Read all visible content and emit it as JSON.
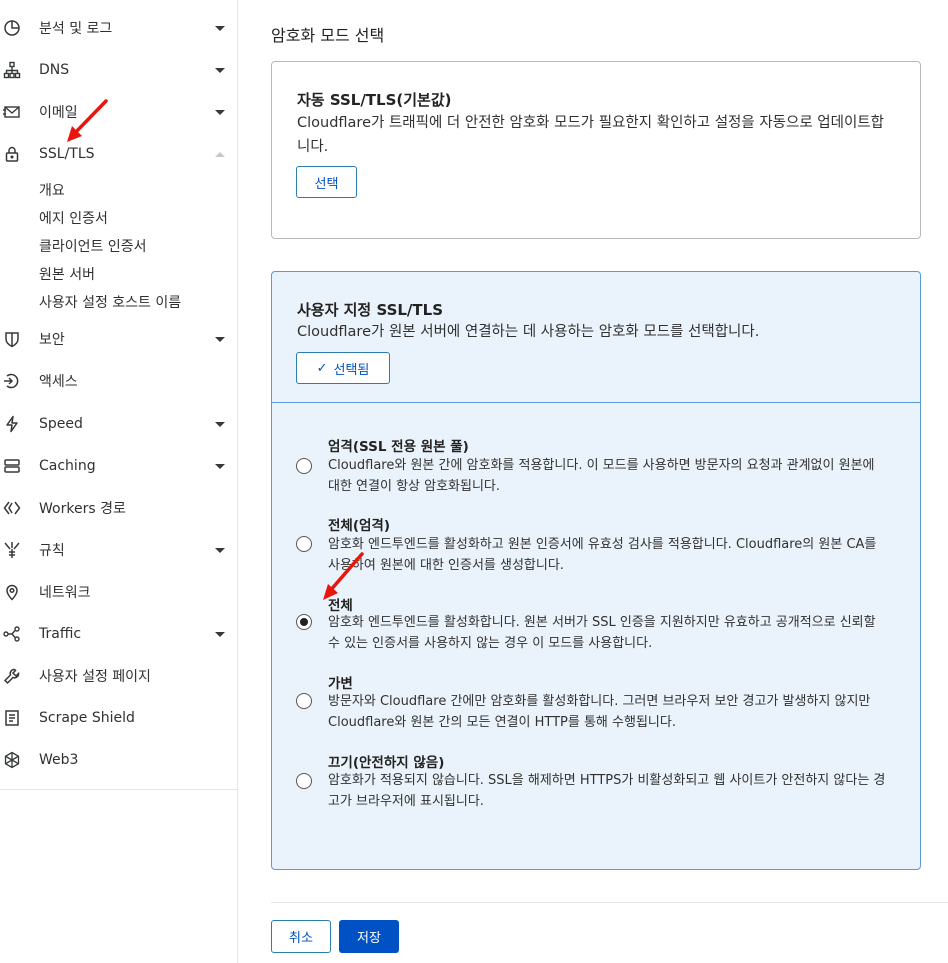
{
  "sidebar": {
    "items": [
      {
        "label": "분석 및 로그",
        "icon": "analytics-icon"
      },
      {
        "label": "DNS",
        "icon": "dns-icon"
      },
      {
        "label": "이메일",
        "icon": "email-icon"
      },
      {
        "label": "SSL/TLS",
        "icon": "lock-icon"
      },
      {
        "label": "보안",
        "icon": "shield-icon"
      },
      {
        "label": "액세스",
        "icon": "access-icon"
      },
      {
        "label": "Speed",
        "icon": "bolt-icon"
      },
      {
        "label": "Caching",
        "icon": "caching-icon"
      },
      {
        "label": "Workers 경로",
        "icon": "workers-icon"
      },
      {
        "label": "규칙",
        "icon": "rules-icon"
      },
      {
        "label": "네트워크",
        "icon": "location-pin-icon"
      },
      {
        "label": "Traffic",
        "icon": "traffic-icon"
      },
      {
        "label": "사용자 설정 페이지",
        "icon": "wrench-icon"
      },
      {
        "label": "Scrape Shield",
        "icon": "document-icon"
      },
      {
        "label": "Web3",
        "icon": "web3-icon"
      }
    ],
    "ssl_sub_items": [
      "개요",
      "에지 인증서",
      "클라이언트 인증서",
      "원본 서버",
      "사용자 설정 호스트 이름"
    ]
  },
  "main": {
    "section_title": "암호화 모드 선택",
    "auto": {
      "title": "자동 SSL/TLS(기본값)",
      "desc": "Cloudflare가 트래픽에 더 안전한 암호화 모드가 필요한지 확인하고 설정을 자동으로 업데이트합니다.",
      "button": "선택"
    },
    "custom": {
      "title": "사용자 지정 SSL/TLS",
      "desc": "Cloudflare가 원본 서버에 연결하는 데 사용하는 암호화 모드를 선택합니다.",
      "button": "선택됨",
      "options": [
        {
          "title": "엄격(SSL 전용 원본 풀)",
          "desc": "Cloudflare와 원본 간에 암호화를 적용합니다. 이 모드를 사용하면 방문자의 요청과 관계없이 원본에 대한 연결이 항상 암호화됩니다.",
          "checked": false
        },
        {
          "title": "전체(엄격)",
          "desc": "암호화 엔드투엔드를 활성화하고 원본 인증서에 유효성 검사를 적용합니다. Cloudflare의 원본 CA를 사용하여 원본에 대한 인증서를 생성합니다.",
          "checked": false
        },
        {
          "title": "전체",
          "desc": "암호화 엔드투엔드를 활성화합니다. 원본 서버가 SSL 인증을 지원하지만 유효하고 공개적으로 신뢰할 수 있는 인증서를 사용하지 않는 경우 이 모드를 사용합니다.",
          "checked": true
        },
        {
          "title": "가변",
          "desc": "방문자와 Cloudflare 간에만 암호화를 활성화합니다. 그러면 브라우저 보안 경고가 발생하지 않지만 Cloudflare와 원본 간의 모든 연결이 HTTP를 통해 수행됩니다.",
          "checked": false
        },
        {
          "title": "끄기(안전하지 않음)",
          "desc": "암호화가 적용되지 않습니다. SSL을 해제하면 HTTPS가 비활성화되고 웹 사이트가 안전하지 않다는 경고가 브라우저에 표시됩니다.",
          "checked": false
        }
      ]
    },
    "cancel_button": "취소",
    "save_button": "저장"
  },
  "colors": {
    "accent": "#0051c3",
    "selected_card_bg": "#eaf3fb",
    "selected_card_border": "#5a9ad6",
    "annotation_arrow": "#e8160c"
  }
}
